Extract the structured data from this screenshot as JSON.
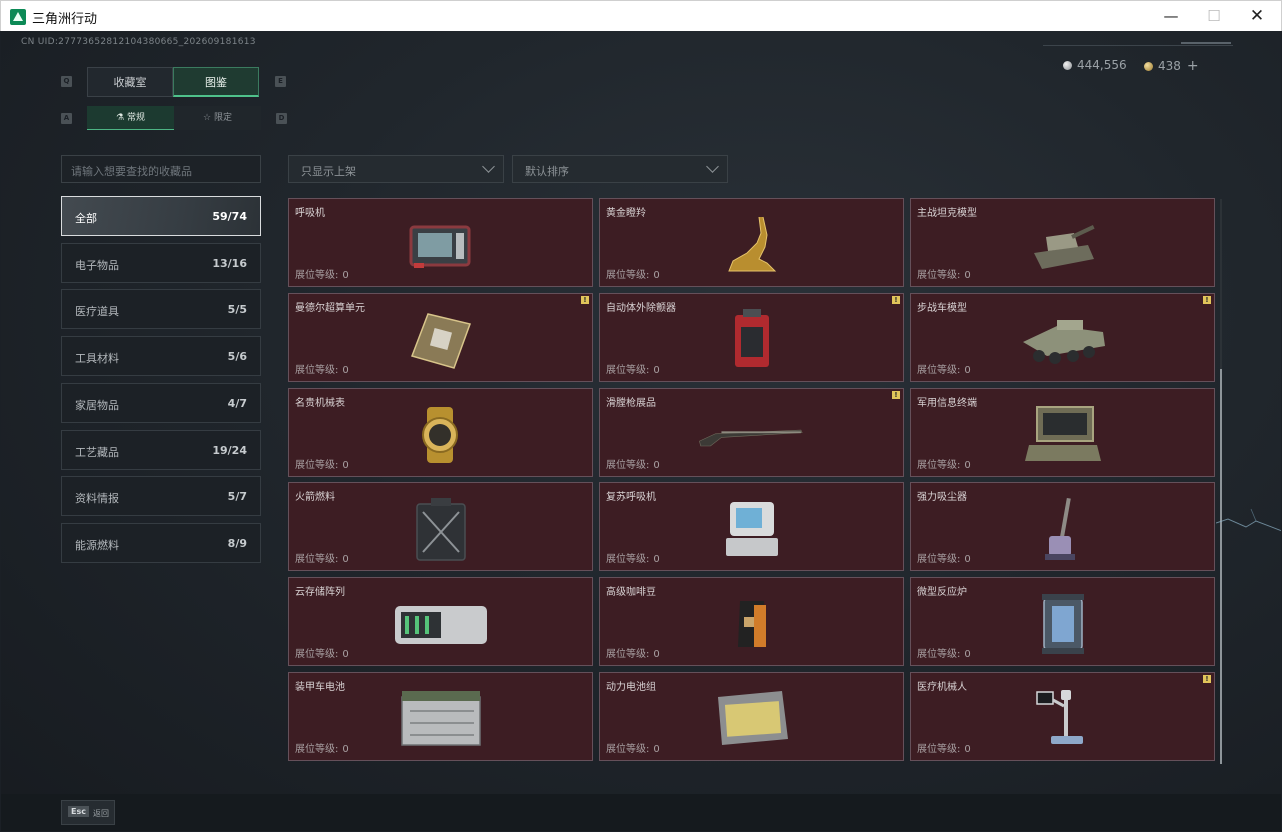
{
  "window": {
    "title": "三角洲行动",
    "min_glyph": "—",
    "max_glyph": "☐",
    "close_glyph": "✕"
  },
  "header": {
    "uid": "CN UID:27773652812104380665_202609181613",
    "currency": [
      {
        "icon": "silver-coin-icon",
        "value": "444,556"
      },
      {
        "icon": "gold-coin-icon",
        "value": "438",
        "plus": "+"
      }
    ]
  },
  "tabs": {
    "primary": [
      {
        "label": "收藏室",
        "key": "Q",
        "active": false
      },
      {
        "label": "图鉴",
        "key": "E",
        "active": true
      }
    ],
    "secondary": [
      {
        "label": "常规",
        "icon": "flask-icon",
        "key": "A",
        "active": true
      },
      {
        "label": "限定",
        "icon": "star-icon",
        "key": "D",
        "active": false
      }
    ]
  },
  "search": {
    "placeholder": "请输入想要查找的收藏品"
  },
  "categories": [
    {
      "name": "全部",
      "count": "59/74",
      "active": true
    },
    {
      "name": "电子物品",
      "count": "13/16"
    },
    {
      "name": "医疗道具",
      "count": "5/5"
    },
    {
      "name": "工具材料",
      "count": "5/6"
    },
    {
      "name": "家居物品",
      "count": "4/7"
    },
    {
      "name": "工艺藏品",
      "count": "19/24"
    },
    {
      "name": "资料情报",
      "count": "5/7"
    },
    {
      "name": "能源燃料",
      "count": "8/9"
    }
  ],
  "filters": {
    "shelf": "只显示上架",
    "sort": "默认排序"
  },
  "level_label": "展位等级:",
  "items": [
    {
      "name": "呼吸机",
      "level": "0",
      "icon": "ventilator-icon",
      "badge": false
    },
    {
      "name": "黄金瞪羚",
      "level": "0",
      "icon": "golden-gazelle-icon",
      "badge": false
    },
    {
      "name": "主战坦克模型",
      "level": "0",
      "icon": "tank-model-icon",
      "badge": false
    },
    {
      "name": "曼德尔超算单元",
      "level": "0",
      "icon": "supercomputer-unit-icon",
      "badge": true
    },
    {
      "name": "自动体外除颤器",
      "level": "0",
      "icon": "defibrillator-icon",
      "badge": true
    },
    {
      "name": "步战车模型",
      "level": "0",
      "icon": "ifv-model-icon",
      "badge": true
    },
    {
      "name": "名贵机械表",
      "level": "0",
      "icon": "watch-icon",
      "badge": false
    },
    {
      "name": "滑膛枪展品",
      "level": "0",
      "icon": "musket-icon",
      "badge": true
    },
    {
      "name": "军用信息终端",
      "level": "0",
      "icon": "military-terminal-icon",
      "badge": false
    },
    {
      "name": "火箭燃料",
      "level": "0",
      "icon": "rocket-fuel-icon",
      "badge": false
    },
    {
      "name": "复苏呼吸机",
      "level": "0",
      "icon": "resuscitator-icon",
      "badge": false
    },
    {
      "name": "强力吸尘器",
      "level": "0",
      "icon": "vacuum-cleaner-icon",
      "badge": false
    },
    {
      "name": "云存储阵列",
      "level": "0",
      "icon": "storage-array-icon",
      "badge": false
    },
    {
      "name": "高级咖啡豆",
      "level": "0",
      "icon": "coffee-bag-icon",
      "badge": false
    },
    {
      "name": "微型反应炉",
      "level": "0",
      "icon": "micro-reactor-icon",
      "badge": false
    },
    {
      "name": "装甲车电池",
      "level": "0",
      "icon": "vehicle-battery-icon",
      "badge": false
    },
    {
      "name": "动力电池组",
      "level": "0",
      "icon": "battery-pack-icon",
      "badge": false
    },
    {
      "name": "医疗机械人",
      "level": "0",
      "icon": "medical-robot-icon",
      "badge": true
    }
  ],
  "badge_glyph": "!",
  "footer": {
    "esc_key": "Esc",
    "esc_label": "返回"
  }
}
